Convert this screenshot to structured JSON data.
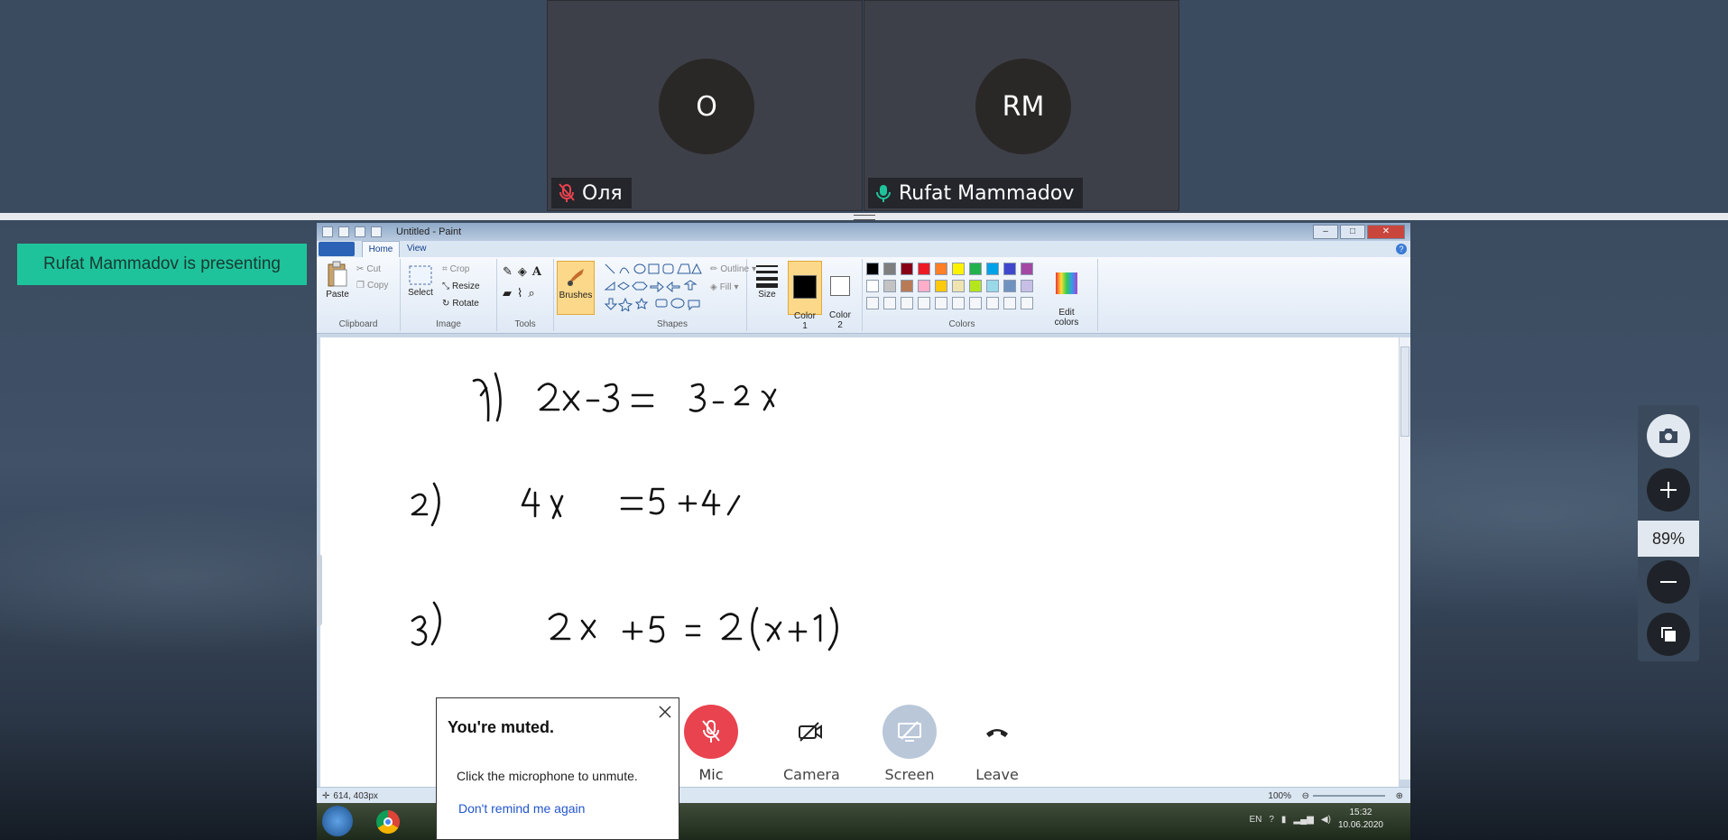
{
  "participants": [
    {
      "initials": "О",
      "name": "Оля",
      "mic": "muted"
    },
    {
      "initials": "RM",
      "name": "Rufat Mammadov",
      "mic": "active"
    }
  ],
  "presenting_banner": "Rufat Mammadov is presenting",
  "paint": {
    "window_title": "Untitled - Paint",
    "tabs": {
      "home": "Home",
      "view": "View"
    },
    "clipboard": {
      "paste": "Paste",
      "cut": "Cut",
      "copy": "Copy",
      "label": "Clipboard"
    },
    "image": {
      "select": "Select",
      "crop": "Crop",
      "resize": "Resize",
      "rotate": "Rotate",
      "label": "Image"
    },
    "tools": {
      "label": "Tools"
    },
    "brushes": "Brushes",
    "shapes": {
      "outline": "Outline",
      "fill": "Fill",
      "label": "Shapes"
    },
    "size": "Size",
    "color1": "Color\n1",
    "color2": "Color\n2",
    "colors_label": "Colors",
    "edit_colors": "Edit\ncolors",
    "palette_row1": [
      "#000000",
      "#7f7f7f",
      "#880015",
      "#ed1c24",
      "#ff7f27",
      "#fff200",
      "#22b14c",
      "#00a2e8",
      "#3f48cc",
      "#a349a4"
    ],
    "palette_row2": [
      "#ffffff",
      "#c3c3c3",
      "#b97a57",
      "#ffaec9",
      "#ffc90e",
      "#efe4b0",
      "#b5e61d",
      "#99d9ea",
      "#7092be",
      "#c8bfe7"
    ],
    "status_position": "614, 403px",
    "status_zoom": "100%",
    "equations": [
      "1)  2x−3 = 3−2x",
      "2)  4x = 5+4",
      "3)  2x+5 = 2(x+1)"
    ]
  },
  "taskbar": {
    "language": "EN",
    "time": "15:32",
    "date": "10.06.2020"
  },
  "controls": {
    "mic": "Mic",
    "camera": "Camera",
    "screen": "Screen",
    "leave": "Leave"
  },
  "muted_popup": {
    "title": "You're muted.",
    "text": "Click the microphone to unmute.",
    "link": "Don't remind me again"
  },
  "side_tools": {
    "zoom": "89%"
  },
  "colors": {
    "accent_green": "#1fc39b",
    "mic_red": "#e8434f",
    "mic_green": "#1fc39b"
  }
}
